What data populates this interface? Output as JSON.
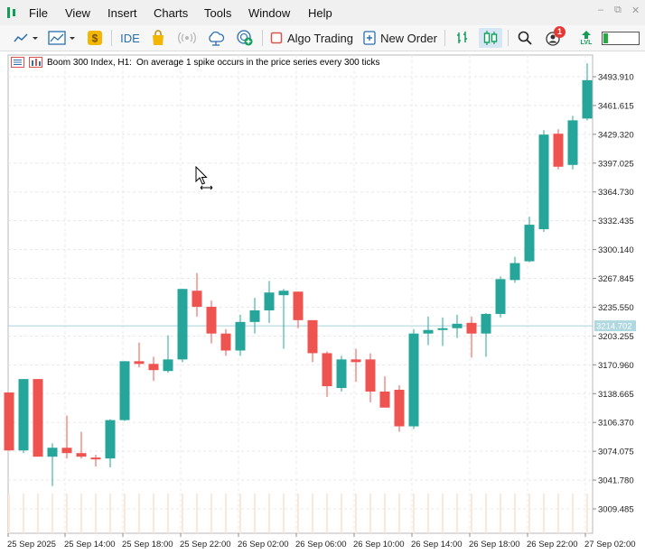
{
  "app": {
    "brand_color": "#0f9d58"
  },
  "menu": {
    "items": [
      {
        "label": "File"
      },
      {
        "label": "View"
      },
      {
        "label": "Insert"
      },
      {
        "label": "Charts"
      },
      {
        "label": "Tools"
      },
      {
        "label": "Window"
      },
      {
        "label": "Help"
      }
    ]
  },
  "toolbar": {
    "ide_label": "IDE",
    "algo_trading_label": "Algo Trading",
    "new_order_label": "New Order",
    "notification_count": "1",
    "lvl_label": "LVL",
    "balance_fill": 0.12
  },
  "chart": {
    "symbol_title": "Boom 300 Index, H1:",
    "description": "On average 1 spike occurs in the price series every 300 ticks",
    "current_price_label": "3214.702",
    "colors": {
      "bull": "#26a69a",
      "bear": "#ef5350",
      "grid": "#e8e8e8",
      "price_line": "#a8d4dc",
      "volume": "#fde8d8"
    }
  },
  "chart_data": {
    "type": "candlestick",
    "title": "Boom 300 Index, H1:",
    "subtitle": "On average 1 spike occurs in the price series every 300 ticks",
    "y_ticks": [
      "3493.910",
      "3461.615",
      "3429.320",
      "3397.025",
      "3364.730",
      "3332.435",
      "3300.140",
      "3267.845",
      "3235.550",
      "3203.255",
      "3170.960",
      "3138.665",
      "3106.370",
      "3074.075",
      "3041.780",
      "3009.485"
    ],
    "x_ticks": [
      "25 Sep 2025",
      "25 Sep 14:00",
      "25 Sep 18:00",
      "25 Sep 22:00",
      "26 Sep 02:00",
      "26 Sep 06:00",
      "26 Sep 10:00",
      "26 Sep 14:00",
      "26 Sep 18:00",
      "26 Sep 22:00",
      "27 Sep 02:00"
    ],
    "current_price": 3214.702,
    "ylim": [
      2985,
      3510
    ],
    "candles": [
      {
        "o": 3140,
        "h": 3140,
        "l": 3075,
        "c": 3075
      },
      {
        "o": 3075,
        "h": 3155,
        "l": 3072,
        "c": 3155
      },
      {
        "o": 3155,
        "h": 3155,
        "l": 3068,
        "c": 3068
      },
      {
        "o": 3068,
        "h": 3083,
        "l": 3035,
        "c": 3078
      },
      {
        "o": 3078,
        "h": 3114,
        "l": 3066,
        "c": 3072
      },
      {
        "o": 3072,
        "h": 3096,
        "l": 3066,
        "c": 3068
      },
      {
        "o": 3067,
        "h": 3070,
        "l": 3057,
        "c": 3066
      },
      {
        "o": 3066,
        "h": 3110,
        "l": 3056,
        "c": 3109
      },
      {
        "o": 3109,
        "h": 3175,
        "l": 3108,
        "c": 3175
      },
      {
        "o": 3175,
        "h": 3196,
        "l": 3168,
        "c": 3172
      },
      {
        "o": 3172,
        "h": 3180,
        "l": 3153,
        "c": 3165
      },
      {
        "o": 3164,
        "h": 3204,
        "l": 3162,
        "c": 3177
      },
      {
        "o": 3177,
        "h": 3256,
        "l": 3174,
        "c": 3256
      },
      {
        "o": 3254,
        "h": 3274,
        "l": 3225,
        "c": 3236
      },
      {
        "o": 3236,
        "h": 3243,
        "l": 3195,
        "c": 3206
      },
      {
        "o": 3206,
        "h": 3211,
        "l": 3181,
        "c": 3187
      },
      {
        "o": 3187,
        "h": 3227,
        "l": 3181,
        "c": 3219
      },
      {
        "o": 3219,
        "h": 3246,
        "l": 3206,
        "c": 3232
      },
      {
        "o": 3232,
        "h": 3265,
        "l": 3218,
        "c": 3252
      },
      {
        "o": 3249,
        "h": 3256,
        "l": 3189,
        "c": 3254
      },
      {
        "o": 3253,
        "h": 3253,
        "l": 3212,
        "c": 3221
      },
      {
        "o": 3221,
        "h": 3221,
        "l": 3174,
        "c": 3184
      },
      {
        "o": 3184,
        "h": 3186,
        "l": 3135,
        "c": 3147
      },
      {
        "o": 3145,
        "h": 3181,
        "l": 3141,
        "c": 3177
      },
      {
        "o": 3177,
        "h": 3189,
        "l": 3152,
        "c": 3174
      },
      {
        "o": 3177,
        "h": 3184,
        "l": 3129,
        "c": 3141
      },
      {
        "o": 3141,
        "h": 3158,
        "l": 3128,
        "c": 3123
      },
      {
        "o": 3143,
        "h": 3148,
        "l": 3096,
        "c": 3102
      },
      {
        "o": 3102,
        "h": 3211,
        "l": 3099,
        "c": 3206
      },
      {
        "o": 3206,
        "h": 3225,
        "l": 3193,
        "c": 3210
      },
      {
        "o": 3210,
        "h": 3224,
        "l": 3192,
        "c": 3212
      },
      {
        "o": 3212,
        "h": 3227,
        "l": 3201,
        "c": 3217
      },
      {
        "o": 3218,
        "h": 3225,
        "l": 3179,
        "c": 3206
      },
      {
        "o": 3206,
        "h": 3229,
        "l": 3180,
        "c": 3228
      },
      {
        "o": 3228,
        "h": 3270,
        "l": 3224,
        "c": 3267
      },
      {
        "o": 3266,
        "h": 3292,
        "l": 3263,
        "c": 3285
      },
      {
        "o": 3287,
        "h": 3337,
        "l": 3286,
        "c": 3328
      },
      {
        "o": 3323,
        "h": 3434,
        "l": 3320,
        "c": 3429
      },
      {
        "o": 3430,
        "h": 3435,
        "l": 3390,
        "c": 3393
      },
      {
        "o": 3395,
        "h": 3450,
        "l": 3390,
        "c": 3445
      },
      {
        "o": 3447,
        "h": 3509,
        "l": 3445,
        "c": 3490
      }
    ]
  }
}
